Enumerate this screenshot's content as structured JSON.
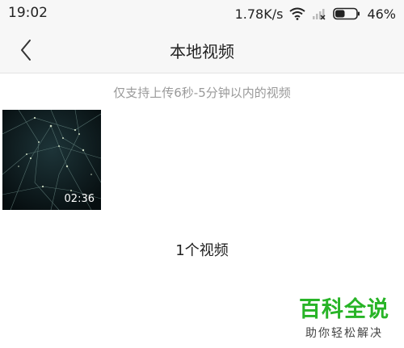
{
  "status_bar": {
    "time": "19:02",
    "network_speed": "1.78K/s",
    "battery_percent": "46%",
    "battery_level": 0.46,
    "icons": [
      "wifi-icon",
      "signal-icon",
      "battery-icon"
    ]
  },
  "header": {
    "title": "本地视频",
    "back_icon": "chevron-left-icon"
  },
  "hint": "仅支持上传6秒-5分钟以内的视频",
  "videos": [
    {
      "duration": "02:36"
    }
  ],
  "video_count": "1个视频",
  "watermark": {
    "title": "百科全说",
    "subtitle": "助你轻松解决"
  },
  "colors": {
    "accent_green": "#28b427",
    "hint_gray": "#9a9a9a",
    "bar_background": "#f7f7f7"
  }
}
